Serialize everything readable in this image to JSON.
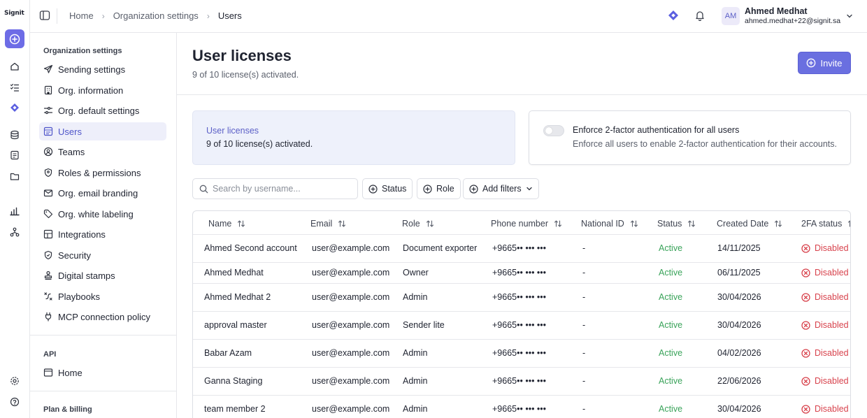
{
  "app": {
    "logo_text": "Signit",
    "breadcrumb": [
      "Home",
      "Organization settings",
      "Users"
    ]
  },
  "user": {
    "initials": "AM",
    "name": "Ahmed Medhat",
    "email": "ahmed.medhat+22@signit.sa"
  },
  "sidebar": {
    "section_title": "Organization settings",
    "items": [
      {
        "label": "Sending settings",
        "icon": "send-icon"
      },
      {
        "label": "Org. information",
        "icon": "building-icon"
      },
      {
        "label": "Org. default settings",
        "icon": "sliders-icon"
      },
      {
        "label": "Users",
        "icon": "users-icon",
        "active": true
      },
      {
        "label": "Teams",
        "icon": "team-icon"
      },
      {
        "label": "Roles & permissions",
        "icon": "shield-icon"
      },
      {
        "label": "Org. email branding",
        "icon": "mail-icon"
      },
      {
        "label": "Org. white labeling",
        "icon": "tag-icon"
      },
      {
        "label": "Integrations",
        "icon": "grid-icon"
      },
      {
        "label": "Security",
        "icon": "security-icon"
      },
      {
        "label": "Digital stamps",
        "icon": "stamp-icon"
      },
      {
        "label": "Playbooks",
        "icon": "playbook-icon"
      },
      {
        "label": "MCP connection policy",
        "icon": "plug-icon"
      }
    ],
    "api_title": "API",
    "api_items": [
      {
        "label": "Home",
        "icon": "code-window-icon"
      }
    ],
    "billing_title": "Plan & billing"
  },
  "main": {
    "title": "User licenses",
    "subtitle": "9 of 10 license(s) activated.",
    "invite_label": "Invite",
    "license_card": {
      "title": "User licenses",
      "text": "9 of 10 license(s) activated."
    },
    "tfa_card": {
      "title": "Enforce 2-factor authentication for all users",
      "text": "Enforce all users to enable 2-factor authentication for their accounts.",
      "enabled": false
    },
    "search_placeholder": "Search by username...",
    "filters": {
      "status": "Status",
      "role": "Role",
      "add": "Add filters"
    }
  },
  "table": {
    "columns": [
      "Name",
      "Email",
      "Role",
      "Phone number",
      "National ID",
      "Status",
      "Created Date",
      "2FA status"
    ],
    "rows": [
      [
        "Ahmed Second account",
        "user@example.com",
        "Document exporter",
        "+9665•• ••• •••",
        "-",
        "Active",
        "14/11/2025",
        "Disabled"
      ],
      [
        "Ahmed Medhat",
        "user@example.com",
        "Owner",
        "+9665•• ••• •••",
        "-",
        "Active",
        "06/11/2025",
        "Disabled"
      ],
      [
        "Ahmed Medhat 2",
        "user@example.com",
        "Admin",
        "+9665•• ••• •••",
        "-",
        "Active",
        "30/04/2026",
        "Disabled"
      ],
      [
        "approval master",
        "user@example.com",
        "Sender lite",
        "+9665•• ••• •••",
        "-",
        "Active",
        "30/04/2026",
        "Disabled"
      ],
      [
        "Babar Azam",
        "user@example.com",
        "Admin",
        "+9665•• ••• •••",
        "-",
        "Active",
        "04/02/2026",
        "Disabled"
      ],
      [
        "Ganna Staging",
        "user@example.com",
        "Admin",
        "+9665•• ••• •••",
        "-",
        "Active",
        "22/06/2026",
        "Disabled"
      ],
      [
        "team member 2",
        "user@example.com",
        "Admin",
        "+9665•• ••• •••",
        "-",
        "Active",
        "30/04/2026",
        "Disabled"
      ]
    ]
  },
  "colors": {
    "accent": "#6a6fe0",
    "active_status": "#3aa35a",
    "disabled_status": "#d8434d"
  }
}
